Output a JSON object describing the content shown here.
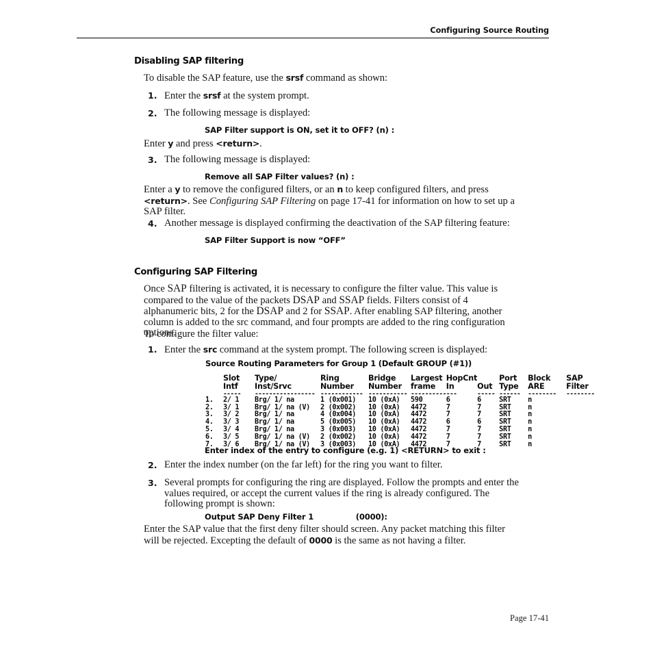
{
  "header": {
    "running_title": "Configuring Source Routing"
  },
  "footer": {
    "page_label": "Page 17-41"
  },
  "sections": {
    "disabling": {
      "heading": "Disabling SAP filtering",
      "intro_a": "To disable the SAP feature, use the ",
      "intro_cmd": "srsf",
      "intro_b": " command as shown:",
      "steps": {
        "s1_num": "1.",
        "s1_a": "Enter the ",
        "s1_cmd": "srsf",
        "s1_b": " at the system prompt.",
        "s2_num": "2.",
        "s2_text": "The following message is displayed:",
        "msg1": "SAP Filter support is ON, set it to OFF? (n) :",
        "after_msg1_a": "Enter ",
        "after_msg1_b": "y",
        "after_msg1_c": " and press ",
        "after_msg1_d": "<return>",
        "after_msg1_e": ".",
        "s3_num": "3.",
        "s3_text": "The following message is displayed:",
        "msg2": "Remove all SAP Filter values? (n) :",
        "s3_body_a": "Enter a ",
        "s3_body_y": "y",
        "s3_body_b": " to remove the configured filters, or an ",
        "s3_body_n": "n",
        "s3_body_c": " to keep configured filters, and press ",
        "s3_body_return": "<return>",
        "s3_body_d": ". See ",
        "s3_body_xref": "Configuring SAP Filtering",
        "s3_body_e": " on page 17-41 for information on how to set up a SAP filter.",
        "s4_num": "4.",
        "s4_text": "Another message is displayed confirming the deactivation of the SAP filtering feature:",
        "msg3": "SAP Filter Support is now “OFF”"
      }
    },
    "configuring": {
      "heading": "Configuring SAP Filtering",
      "para1_1": "Once ",
      "para1_sc1": "SAP",
      "para1_2": " filtering is activated, it is necessary to configure the filter value. This value is compared to the value of the packets ",
      "para1_sc2": "DSAP",
      "para1_3": " and ",
      "para1_sc3": "SSAP",
      "para1_4": " fields. Filters consist of 4 alphanumeric bits, 2 for the ",
      "para1_sc4": "DSAP",
      "para1_5": " and 2 for ",
      "para1_sc5": "SSAP",
      "para1_6": ". After enabling SAP filtering, another column is added to the src command, and four prompts are added to the ring configuration options.",
      "para2": "To configure the filter value:",
      "steps": {
        "s1_num": "1.",
        "s1_a": "Enter the ",
        "s1_cmd": "src",
        "s1_b": " command at the system prompt. The following screen is displayed:",
        "prompt_index": "Enter index of the entry to configure (e.g. 1) <RETURN> to exit :",
        "s2_num": "2.",
        "s2_text": "Enter the index number (on the far left) for the ring you want to filter.",
        "s3_num": "3.",
        "s3_text": "Several prompts for configuring the ring are displayed. Follow the prompts and enter the values required, or accept the current values if the ring is already configured. The following prompt is shown:",
        "prompt_output": "Output SAP Deny Filter 1                (0000):",
        "closing_a": "Enter the SAP value that the first deny filter should screen. Any packet matching this filter will be rejected. Excepting the default of ",
        "closing_bold": "0000",
        "closing_b": " is the same as not having a filter."
      }
    }
  },
  "screen_capture": {
    "title": "Source Routing Parameters for Group 1 (Default GROUP (#1))",
    "headers_top": [
      "",
      "Slot",
      "Type/",
      "Ring",
      "Bridge",
      "Largest",
      "HopCnt",
      "",
      "Port",
      "Block",
      "SAP"
    ],
    "headers_bottom": [
      "",
      "Intf",
      "Inst/Srvc",
      "Number",
      "Number",
      "frame",
      "In",
      "Out",
      "Type",
      "ARE",
      "Filter"
    ],
    "rules": [
      "",
      "-----",
      "-----------------",
      "------------",
      "-----------",
      "----------",
      "---",
      "-----",
      "------",
      "--------",
      "--------"
    ],
    "rows": [
      {
        "index": "1.",
        "slot_intf": "2/ 1",
        "type_inst_srvc": "Brg/ 1/ na",
        "ring_number": "1 (0x001)",
        "bridge_number": "10 (0xA)",
        "largest_frame": "590",
        "hop_in": "6",
        "hop_out": "6",
        "port_type": "SRT",
        "block_are": "n",
        "sap_filter": ""
      },
      {
        "index": "2.",
        "slot_intf": "3/ 1",
        "type_inst_srvc": "Brg/ 1/ na (V)",
        "ring_number": "2 (0x002)",
        "bridge_number": "10 (0xA)",
        "largest_frame": "4472",
        "hop_in": "7",
        "hop_out": "7",
        "port_type": "SRT",
        "block_are": "n",
        "sap_filter": ""
      },
      {
        "index": "3.",
        "slot_intf": "3/ 2",
        "type_inst_srvc": "Brg/ 1/ na",
        "ring_number": "4 (0x004)",
        "bridge_number": "10 (0xA)",
        "largest_frame": "4472",
        "hop_in": "7",
        "hop_out": "7",
        "port_type": "SRT",
        "block_are": "n",
        "sap_filter": ""
      },
      {
        "index": "4.",
        "slot_intf": "3/ 3",
        "type_inst_srvc": "Brg/ 1/ na",
        "ring_number": "5 (0x005)",
        "bridge_number": "10 (0xA)",
        "largest_frame": "4472",
        "hop_in": "6",
        "hop_out": "6",
        "port_type": "SRT",
        "block_are": "n",
        "sap_filter": ""
      },
      {
        "index": "5.",
        "slot_intf": "3/ 4",
        "type_inst_srvc": "Brg/ 1/ na",
        "ring_number": "3 (0x003)",
        "bridge_number": "10 (0xA)",
        "largest_frame": "4472",
        "hop_in": "7",
        "hop_out": "7",
        "port_type": "SRT",
        "block_are": "n",
        "sap_filter": ""
      },
      {
        "index": "6.",
        "slot_intf": "3/ 5",
        "type_inst_srvc": "Brg/ 1/ na (V)",
        "ring_number": "2 (0x002)",
        "bridge_number": "10 (0xA)",
        "largest_frame": "4472",
        "hop_in": "7",
        "hop_out": "7",
        "port_type": "SRT",
        "block_are": "n",
        "sap_filter": ""
      },
      {
        "index": "7.",
        "slot_intf": "3/ 6",
        "type_inst_srvc": "Brg/ 1/ na (V)",
        "ring_number": "3 (0x003)",
        "bridge_number": "10 (0xA)",
        "largest_frame": "4472",
        "hop_in": "7",
        "hop_out": "7",
        "port_type": "SRT",
        "block_are": "n",
        "sap_filter": ""
      }
    ]
  }
}
